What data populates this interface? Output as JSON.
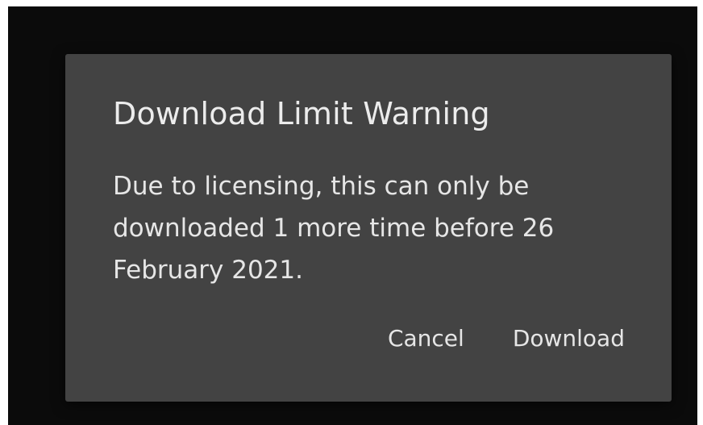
{
  "dialog": {
    "title": "Download Limit Warning",
    "message": "Due to licensing, this can only be downloaded 1 more time before 26 February 2021.",
    "cancel_label": "Cancel",
    "download_label": "Download"
  },
  "colors": {
    "backdrop": "#0b0b0b",
    "dialog_background": "#434343",
    "text": "#e6e6e6"
  }
}
